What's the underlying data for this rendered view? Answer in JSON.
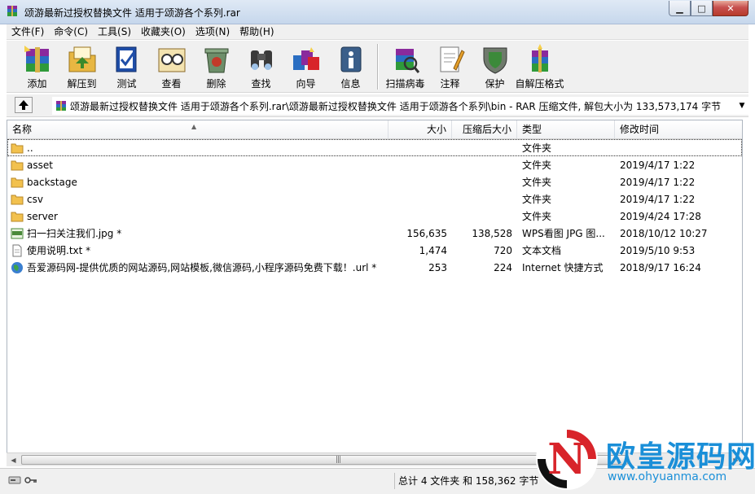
{
  "window": {
    "title": "颂游最新过授权替换文件  适用于颂游各个系列.rar",
    "minimize_label": "▁",
    "maximize_label": "□",
    "close_label": "✕"
  },
  "menu": [
    {
      "label": "文件(F)"
    },
    {
      "label": "命令(C)"
    },
    {
      "label": "工具(S)"
    },
    {
      "label": "收藏夹(O)"
    },
    {
      "label": "选项(N)"
    },
    {
      "label": "帮助(H)"
    }
  ],
  "toolbar": [
    {
      "label": "添加",
      "icon": "add-archive-icon"
    },
    {
      "label": "解压到",
      "icon": "extract-to-icon"
    },
    {
      "label": "测试",
      "icon": "test-icon"
    },
    {
      "label": "查看",
      "icon": "view-icon"
    },
    {
      "label": "删除",
      "icon": "delete-icon"
    },
    {
      "label": "查找",
      "icon": "find-icon"
    },
    {
      "label": "向导",
      "icon": "wizard-icon"
    },
    {
      "label": "信息",
      "icon": "info-icon"
    },
    {
      "label": "扫描病毒",
      "icon": "virus-scan-icon"
    },
    {
      "label": "注释",
      "icon": "comment-icon"
    },
    {
      "label": "保护",
      "icon": "protect-icon"
    },
    {
      "label": "自解压格式",
      "icon": "sfx-icon"
    }
  ],
  "address": {
    "path": "颂游最新过授权替换文件  适用于颂游各个系列.rar\\颂游最新过授权替换文件  适用于颂游各个系列\\bin - RAR 压缩文件, 解包大小为 133,573,174 字节"
  },
  "columns": {
    "name": "名称",
    "size": "大小",
    "packed": "压缩后大小",
    "type": "类型",
    "modified": "修改时间"
  },
  "rows": [
    {
      "name": "..",
      "size": "",
      "packed": "",
      "type": "文件夹",
      "modified": "",
      "icon": "folder-icon"
    },
    {
      "name": "asset",
      "size": "",
      "packed": "",
      "type": "文件夹",
      "modified": "2019/4/17 1:22",
      "icon": "folder-icon"
    },
    {
      "name": "backstage",
      "size": "",
      "packed": "",
      "type": "文件夹",
      "modified": "2019/4/17 1:22",
      "icon": "folder-icon"
    },
    {
      "name": "csv",
      "size": "",
      "packed": "",
      "type": "文件夹",
      "modified": "2019/4/17 1:22",
      "icon": "folder-icon"
    },
    {
      "name": "server",
      "size": "",
      "packed": "",
      "type": "文件夹",
      "modified": "2019/4/24 17:28",
      "icon": "folder-icon"
    },
    {
      "name": "扫一扫关注我们.jpg *",
      "size": "156,635",
      "packed": "138,528",
      "type": "WPS看图 JPG 图...",
      "modified": "2018/10/12 10:27",
      "icon": "jpeg-file-icon"
    },
    {
      "name": "使用说明.txt *",
      "size": "1,474",
      "packed": "720",
      "type": "文本文档",
      "modified": "2019/5/10 9:53",
      "icon": "text-file-icon"
    },
    {
      "name": "吾爱源码网-提供优质的网站源码,网站模板,微信源码,小程序源码免费下载！.url *",
      "size": "253",
      "packed": "224",
      "type": "Internet 快捷方式",
      "modified": "2018/9/17 16:24",
      "icon": "internet-shortcut-icon"
    }
  ],
  "status": {
    "text": "总计 4 文件夹 和 158,362 字节"
  },
  "watermark": {
    "logo_letter": "N",
    "cn": "欧皇源码网",
    "url": "www.ohyuanma.com"
  },
  "colors": {
    "watermark_blue": "#1a8fd8",
    "watermark_red": "#d8242a",
    "folder_yellow": "#f2c14e"
  }
}
